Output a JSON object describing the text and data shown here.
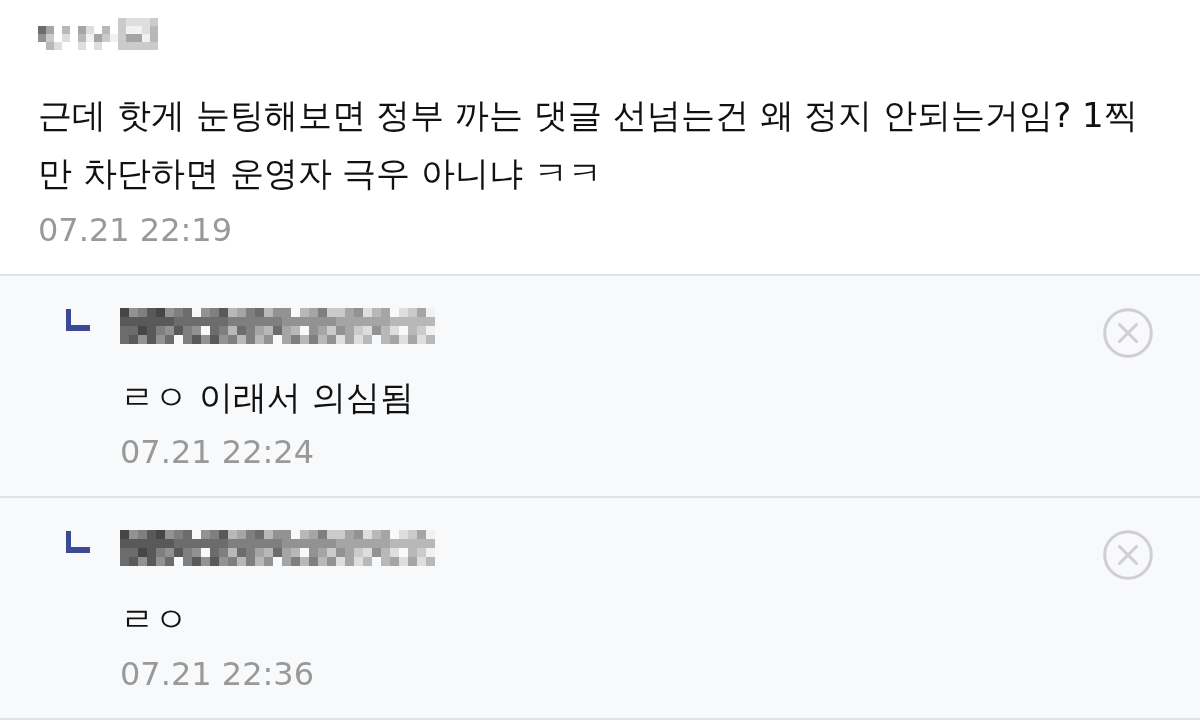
{
  "comment": {
    "text": "근데 핫게 눈팅해보면 정부 까는 댓글 선넘는건 왜 정지 안되는거임? 1찍만 차단하면 운영자 극우 아니냐 ㅋㅋ",
    "time": "07.21 22:19"
  },
  "replies": [
    {
      "text": "ㄹㅇ 이래서 의심됨",
      "time": "07.21 22:24"
    },
    {
      "text": "ㄹㅇ",
      "time": "07.21 22:36"
    }
  ]
}
